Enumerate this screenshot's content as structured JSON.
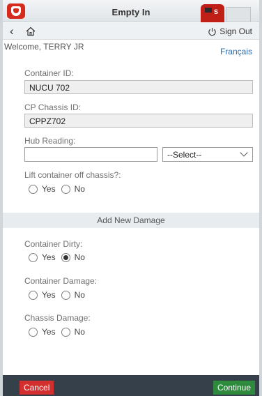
{
  "header": {
    "title": "Empty In"
  },
  "toolbar": {
    "sign_out": "Sign Out"
  },
  "welcome": "Welcome, TERRY JR",
  "language_link": "Français",
  "form": {
    "container_id_label": "Container ID:",
    "container_id_value": "NUCU 702",
    "chassis_id_label": "CP Chassis ID:",
    "chassis_id_value": "CPPZ702",
    "hub_reading_label": "Hub Reading:",
    "hub_reading_value": "",
    "hub_unit_selected": "--Select--",
    "lift_label": "Lift container off chassis?:",
    "yes": "Yes",
    "no": "No"
  },
  "damage_section": {
    "title": "Add New Damage",
    "container_dirty_label": "Container Dirty:",
    "container_dirty_selected": "No",
    "container_damage_label": "Container Damage:",
    "chassis_damage_label": "Chassis Damage:"
  },
  "footer": {
    "cancel": "Cancel",
    "continue": "Continue"
  },
  "colors": {
    "cancel": "#d32f2f",
    "continue": "#2e8b3e",
    "footer": "#35404a",
    "brand": "#d52b1e",
    "link": "#2a6aad"
  }
}
